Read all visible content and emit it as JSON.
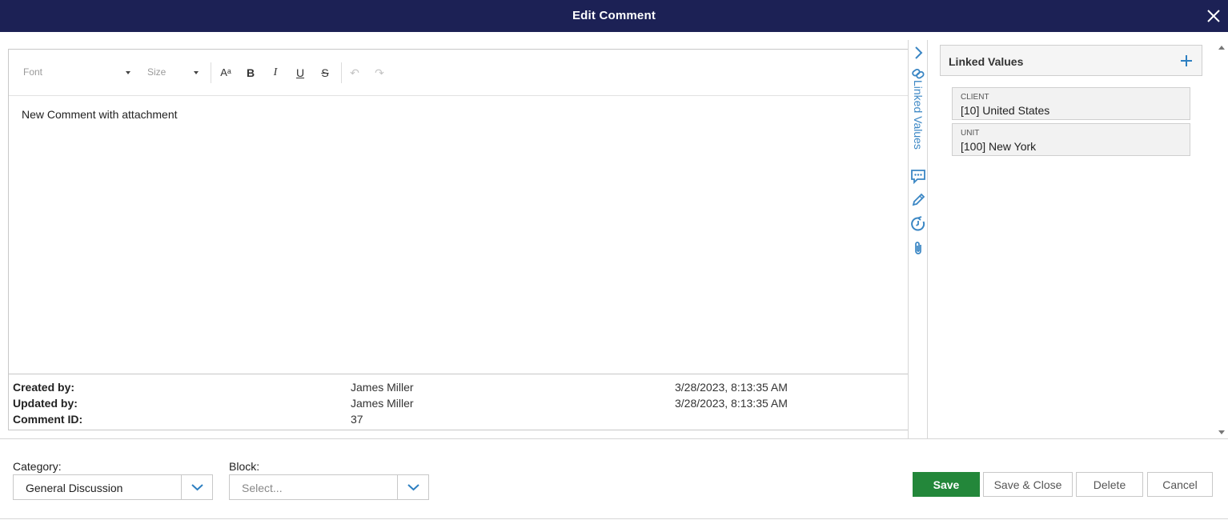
{
  "dialog": {
    "title": "Edit Comment"
  },
  "toolbar": {
    "font_placeholder": "Font",
    "size_placeholder": "Size",
    "font_size_glyph": "Aᵃ",
    "bold_glyph": "B",
    "italic_glyph": "I",
    "underline_glyph": "U",
    "strike_glyph": "S",
    "undo_glyph": "↶",
    "redo_glyph": "↷"
  },
  "editor": {
    "content": "New Comment with attachment"
  },
  "meta": {
    "created_label": "Created by:",
    "created_by": "James Miller",
    "created_at": "3/28/2023, 8:13:35 AM",
    "updated_label": "Updated by:",
    "updated_by": "James Miller",
    "updated_at": "3/28/2023, 8:13:35 AM",
    "id_label": "Comment ID:",
    "comment_id": "37"
  },
  "side_tabs": {
    "linked_values_label": "Linked Values"
  },
  "linked_values": {
    "title": "Linked Values",
    "items": [
      {
        "key": "CLIENT",
        "value": "[10] United States"
      },
      {
        "key": "UNIT",
        "value": "[100] New York"
      }
    ]
  },
  "footer": {
    "category_label": "Category:",
    "category_value": "General Discussion",
    "block_label": "Block:",
    "block_placeholder": "Select...",
    "save": "Save",
    "save_close": "Save & Close",
    "delete": "Delete",
    "cancel": "Cancel"
  },
  "colors": {
    "header": "#1c2155",
    "accent": "#3a86c4",
    "primary_button": "#23873a"
  }
}
